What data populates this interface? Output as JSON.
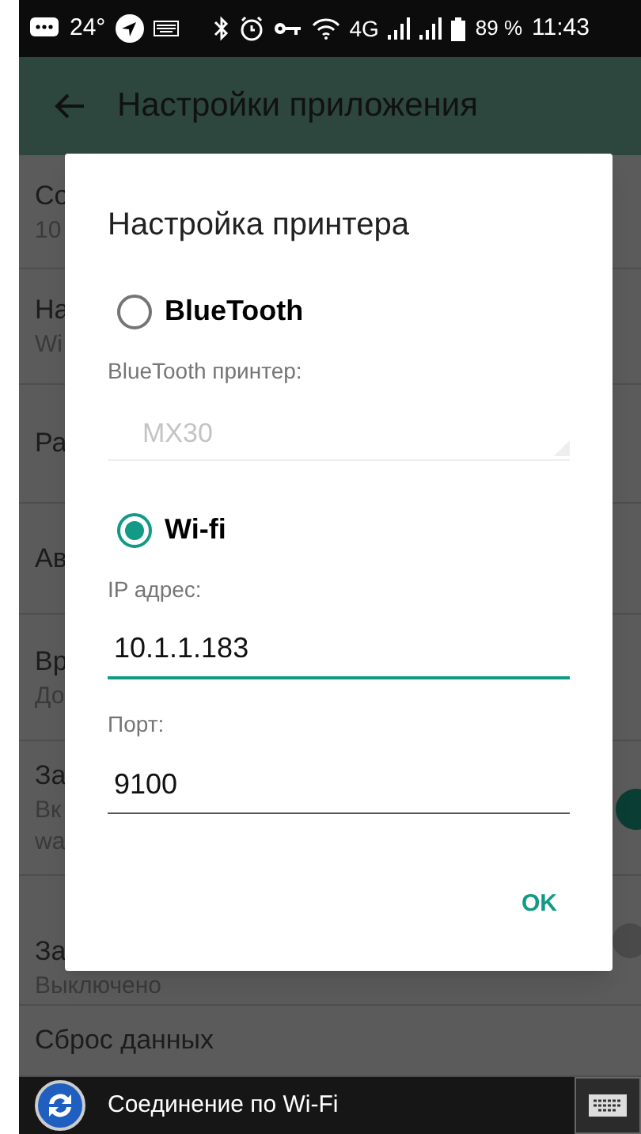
{
  "status_bar": {
    "temperature": "24°",
    "network": "4G",
    "battery": "89 %",
    "time": "11:43"
  },
  "app_bar": {
    "title": "Настройки приложения"
  },
  "settings": [
    {
      "title": "Со",
      "lines": [
        "10"
      ]
    },
    {
      "title": "На",
      "lines": [
        "Wi"
      ]
    },
    {
      "title": "Ра"
    },
    {
      "title": "Ав"
    },
    {
      "title": "Вр",
      "lines": [
        "До"
      ]
    },
    {
      "title": "За",
      "lines": [
        "Вк",
        "wa"
      ],
      "switch_on": true
    },
    {
      "title": "За",
      "lines": [
        "Выключено"
      ],
      "switch_on": false
    },
    {
      "title": "Сброс данных"
    }
  ],
  "dialog": {
    "title": "Настройка принтера",
    "items": [
      {
        "kind": "radio",
        "label": "BlueTooth",
        "selected": false
      },
      {
        "kind": "caption",
        "text": "BlueTooth принтер:"
      },
      {
        "kind": "field",
        "value": "MX30",
        "disabled": true,
        "focused": false
      },
      {
        "kind": "radio",
        "label": "Wi-fi",
        "selected": true
      },
      {
        "kind": "caption",
        "text": "IP адрес:"
      },
      {
        "kind": "field",
        "value": "10.1.1.183",
        "disabled": false,
        "focused": true
      },
      {
        "kind": "caption",
        "text": "Порт:"
      },
      {
        "kind": "field",
        "value": "9100",
        "disabled": false,
        "focused": false
      }
    ],
    "button": "OK"
  },
  "notification": {
    "text": "Соединение по Wi-Fi"
  }
}
